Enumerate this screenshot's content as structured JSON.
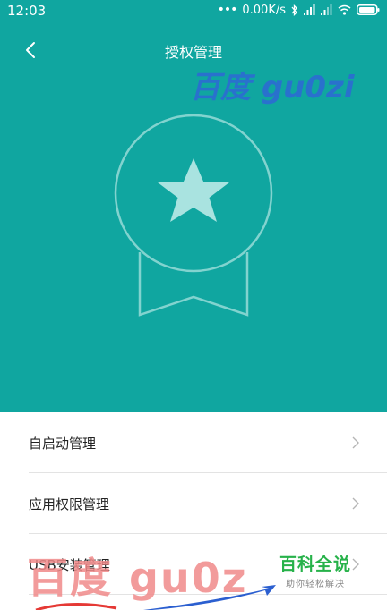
{
  "status_bar": {
    "time": "12:03",
    "network_speed": "0.00K/s",
    "icons": [
      "more-dots-icon",
      "bluetooth-icon",
      "signal-icon",
      "signal-icon",
      "wifi-icon",
      "battery-icon"
    ]
  },
  "header": {
    "title": "授权管理",
    "back_icon": "chevron-left-icon",
    "background_color": "#10a6a0",
    "illustration_icon": "star-badge-icon"
  },
  "list": {
    "items": [
      {
        "label": "自启动管理",
        "icon": "chevron-right-icon"
      },
      {
        "label": "应用权限管理",
        "icon": "chevron-right-icon"
      },
      {
        "label": "USB安装管理",
        "icon": "chevron-right-icon"
      }
    ]
  },
  "watermarks": {
    "top": "百度 gu0zi",
    "bottom": "百度 gu0z",
    "logo_title": "百科全说",
    "logo_subtitle": "助你轻松解决"
  }
}
